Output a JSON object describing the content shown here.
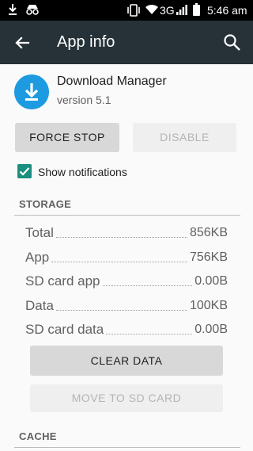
{
  "status_bar": {
    "network": "3G",
    "time": "5:46 am"
  },
  "app_bar": {
    "title": "App info"
  },
  "app": {
    "name": "Download Manager",
    "version": "version 5.1"
  },
  "buttons": {
    "force_stop": "FORCE STOP",
    "disable": "DISABLE",
    "clear_data": "CLEAR DATA",
    "move_to_sd": "MOVE TO SD CARD"
  },
  "notifications": {
    "label": "Show notifications",
    "checked": true
  },
  "storage": {
    "title": "STORAGE",
    "rows": [
      {
        "label": "Total",
        "value": "856KB"
      },
      {
        "label": "App",
        "value": "756KB"
      },
      {
        "label": "SD card app",
        "value": "0.00B"
      },
      {
        "label": "Data",
        "value": "100KB"
      },
      {
        "label": "SD card data",
        "value": "0.00B"
      }
    ]
  },
  "cache": {
    "title": "CACHE"
  },
  "colors": {
    "app_bar": "#263238",
    "app_icon": "#1e9be0",
    "checkbox": "#1b8f7f"
  }
}
